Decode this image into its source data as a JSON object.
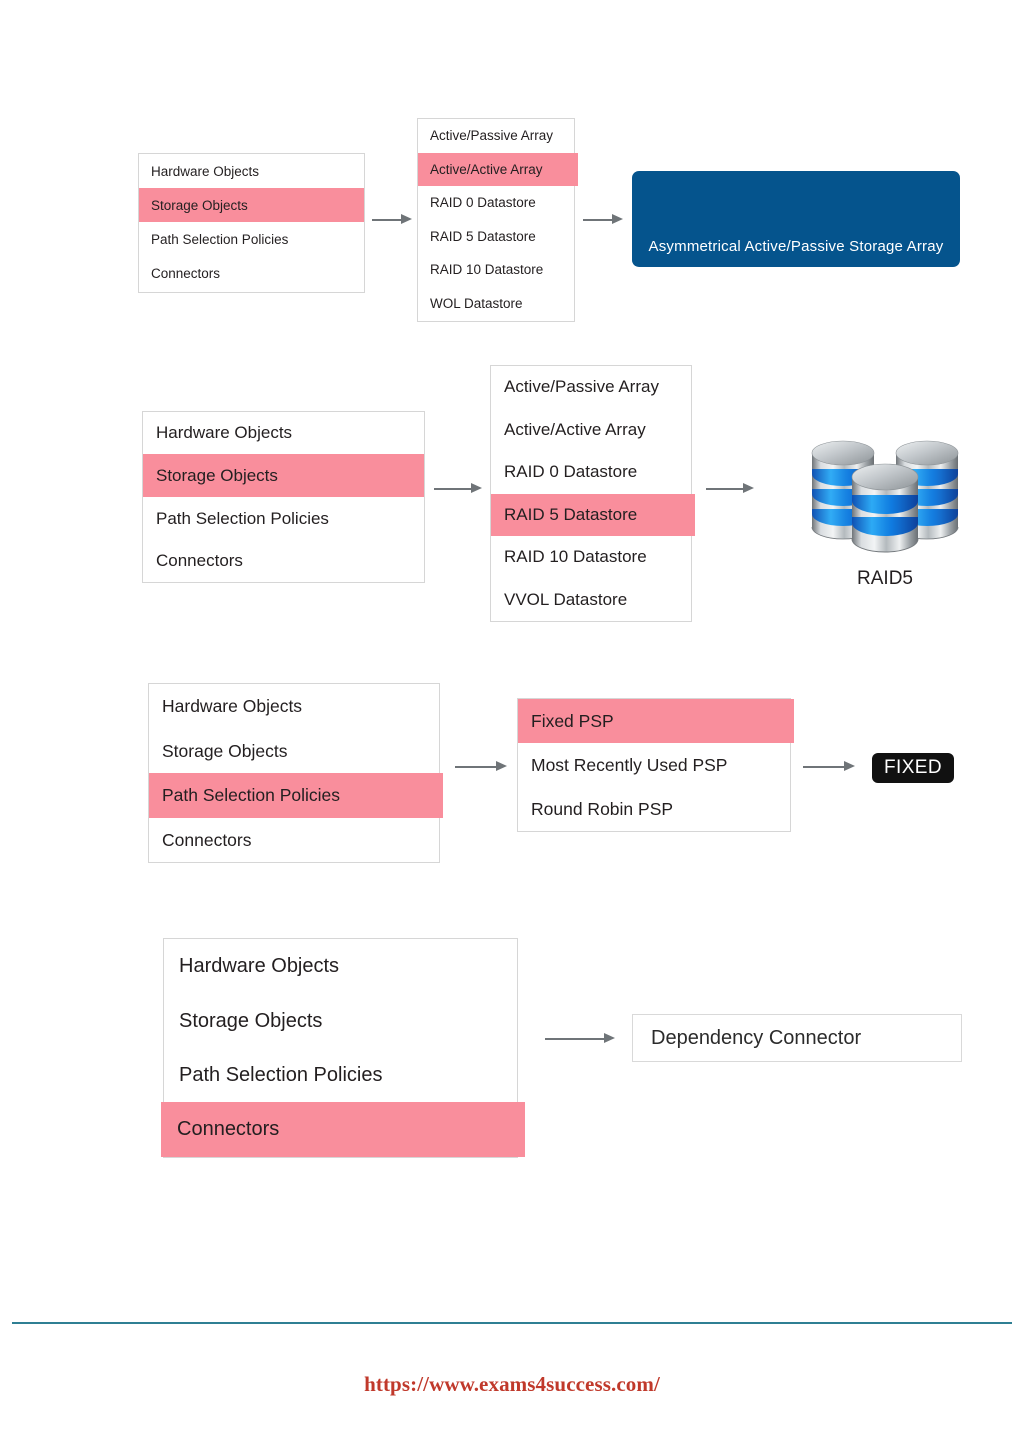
{
  "colors": {
    "highlight_pink": "#F98E9C",
    "result_blue": "#05548D",
    "badge_black": "#111111",
    "arrow_gray": "#6F7478",
    "divider_teal": "#2F7F93",
    "footer_red": "#C0392B"
  },
  "rows": [
    {
      "id": "row-1",
      "category_list": {
        "items": [
          {
            "label": "Hardware Objects",
            "highlighted": false
          },
          {
            "label": "Storage Objects",
            "highlighted": true
          },
          {
            "label": "Path Selection Policies",
            "highlighted": false
          },
          {
            "label": "Connectors",
            "highlighted": false
          }
        ]
      },
      "option_list": {
        "items": [
          {
            "label": "Active/Passive Array",
            "highlighted": false
          },
          {
            "label": "Active/Active Array",
            "highlighted": true
          },
          {
            "label": "RAID 0 Datastore",
            "highlighted": false
          },
          {
            "label": "RAID 5 Datastore",
            "highlighted": false
          },
          {
            "label": "RAID 10 Datastore",
            "highlighted": false
          },
          {
            "label": "WOL Datastore",
            "highlighted": false
          }
        ]
      },
      "result": {
        "type": "blue-box",
        "label": "Asymmetrical Active/Passive Storage Array"
      }
    },
    {
      "id": "row-2",
      "category_list": {
        "items": [
          {
            "label": "Hardware Objects",
            "highlighted": false
          },
          {
            "label": "Storage Objects",
            "highlighted": true
          },
          {
            "label": "Path Selection Policies",
            "highlighted": false
          },
          {
            "label": "Connectors",
            "highlighted": false
          }
        ]
      },
      "option_list": {
        "items": [
          {
            "label": "Active/Passive Array",
            "highlighted": false
          },
          {
            "label": "Active/Active Array",
            "highlighted": false
          },
          {
            "label": "RAID 0 Datastore",
            "highlighted": false
          },
          {
            "label": "RAID 5 Datastore",
            "highlighted": true
          },
          {
            "label": "RAID 10 Datastore",
            "highlighted": false
          },
          {
            "label": "VVOL Datastore",
            "highlighted": false
          }
        ]
      },
      "result": {
        "type": "raid-disks",
        "label": "RAID5"
      }
    },
    {
      "id": "row-3",
      "category_list": {
        "items": [
          {
            "label": "Hardware Objects",
            "highlighted": false
          },
          {
            "label": "Storage Objects",
            "highlighted": false
          },
          {
            "label": "Path Selection Policies",
            "highlighted": true
          },
          {
            "label": "Connectors",
            "highlighted": false
          }
        ]
      },
      "option_list": {
        "items": [
          {
            "label": "Fixed PSP",
            "highlighted": true
          },
          {
            "label": "Most Recently Used PSP",
            "highlighted": false
          },
          {
            "label": "Round Robin PSP",
            "highlighted": false
          }
        ]
      },
      "result": {
        "type": "badge",
        "label": "FIXED"
      }
    },
    {
      "id": "row-4",
      "category_list": {
        "items": [
          {
            "label": "Hardware Objects",
            "highlighted": false
          },
          {
            "label": "Storage Objects",
            "highlighted": false
          },
          {
            "label": "Path Selection Policies",
            "highlighted": false
          },
          {
            "label": "Connectors",
            "highlighted": true
          }
        ]
      },
      "result": {
        "type": "plain-box",
        "label": "Dependency Connector"
      }
    }
  ],
  "footer": {
    "url": "https://www.exams4success.com/"
  }
}
